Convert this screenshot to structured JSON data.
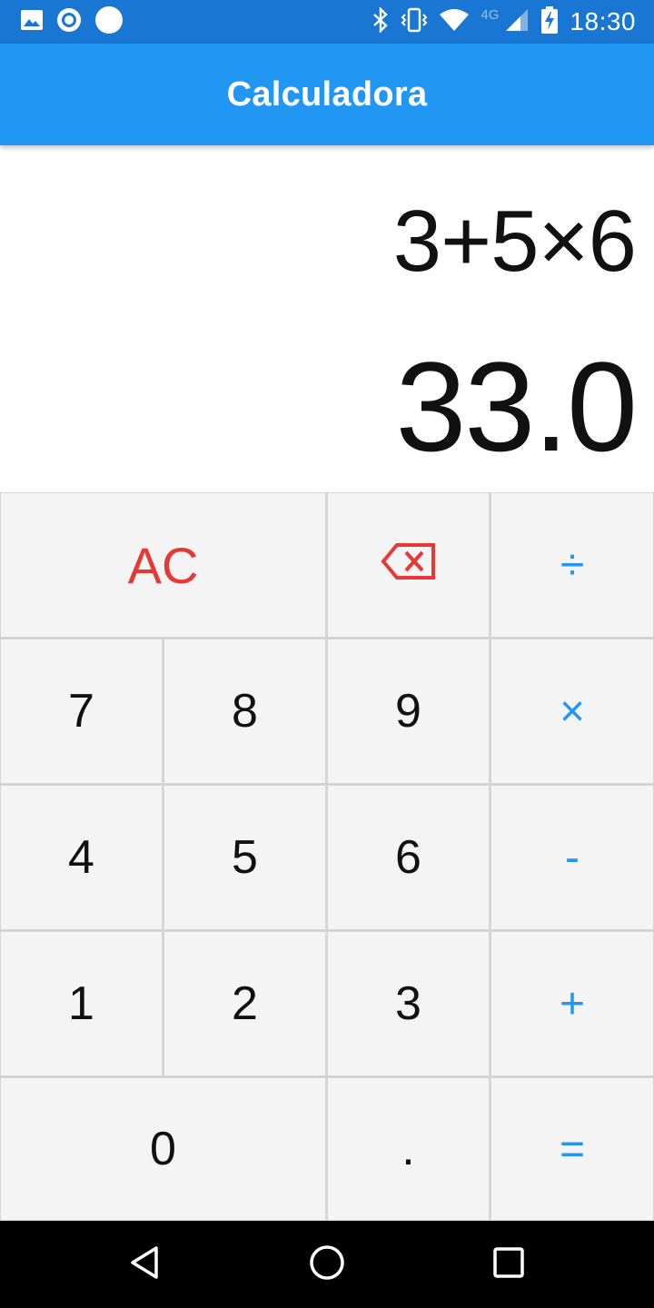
{
  "status_bar": {
    "time": "18:30",
    "network": "4G",
    "icons": [
      "image-icon",
      "record-icon",
      "circle-icon",
      "bluetooth-icon",
      "vibrate-icon",
      "wifi-icon",
      "signal-icon",
      "battery-charging-icon"
    ]
  },
  "app_bar": {
    "title": "Calculadora"
  },
  "display": {
    "expression": "3+5×6",
    "result": "33.0"
  },
  "keypad": {
    "ac": "AC",
    "backspace_icon": "backspace-icon",
    "divide": "÷",
    "seven": "7",
    "eight": "8",
    "nine": "9",
    "multiply": "×",
    "four": "4",
    "five": "5",
    "six": "6",
    "minus": "-",
    "one": "1",
    "two": "2",
    "three": "3",
    "plus": "+",
    "zero": "0",
    "dot": ".",
    "equals": "="
  },
  "nav_bar": {
    "icons": [
      "back-icon",
      "home-icon",
      "recents-icon"
    ]
  },
  "colors": {
    "status_bar": "#1976d2",
    "app_bar": "#2196f3",
    "operator": "#2196f3",
    "clear": "#e53935",
    "key_bg": "#f4f4f4"
  }
}
